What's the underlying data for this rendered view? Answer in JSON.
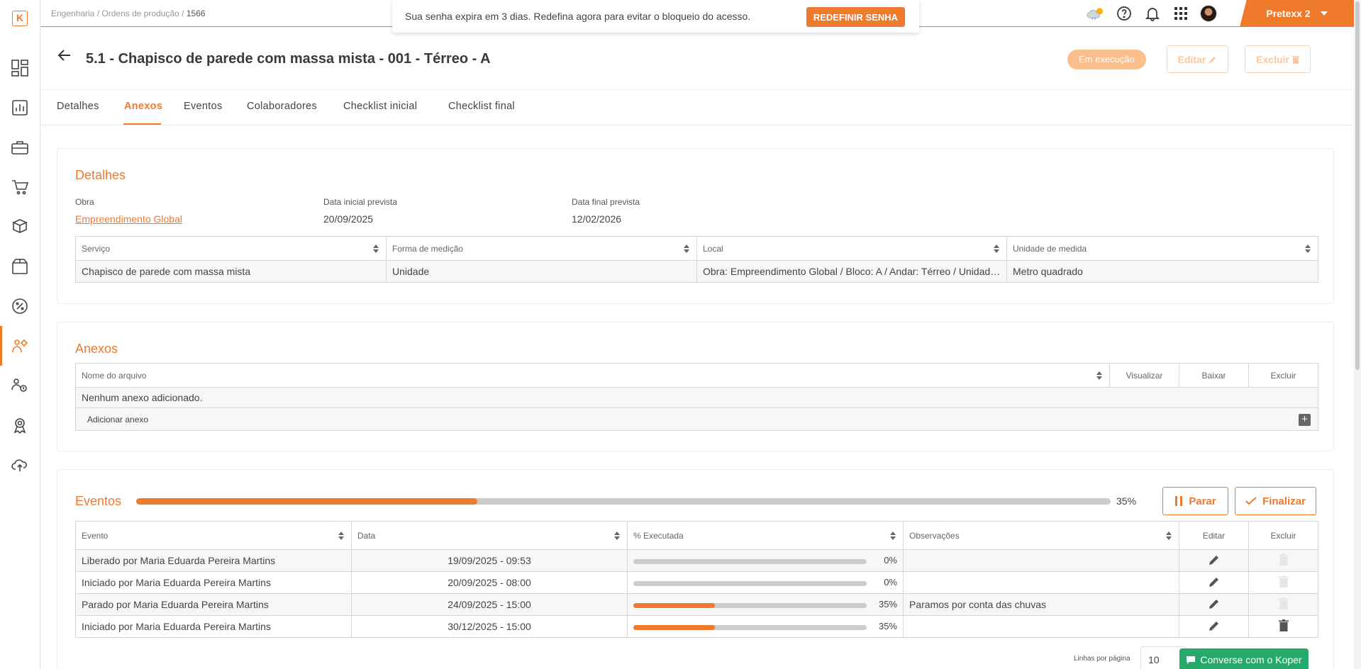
{
  "colors": {
    "accent": "#f07a2b",
    "chat": "#27a96b"
  },
  "logo": {
    "text": "K"
  },
  "sidebar": {
    "items": [
      {
        "icon": "dashboard-icon"
      },
      {
        "icon": "bar-chart-icon"
      },
      {
        "icon": "briefcase-icon"
      },
      {
        "icon": "cart-icon"
      },
      {
        "icon": "boxes-icon"
      },
      {
        "icon": "package-icon"
      },
      {
        "icon": "percent-icon"
      },
      {
        "icon": "engineering-icon",
        "active": true
      },
      {
        "icon": "team-settings-icon"
      },
      {
        "icon": "award-icon"
      },
      {
        "icon": "cloud-upload-icon"
      }
    ]
  },
  "breadcrumb": {
    "part1": "Engenharia",
    "sep": "/",
    "part2": "Ordens de produção",
    "current": "1566"
  },
  "alert": {
    "text": "Sua senha expira em 3 dias. Redefina agora para evitar o bloqueio do acesso.",
    "button": "REDEFINIR SENHA"
  },
  "topbar": {
    "user": "Pretexx 2"
  },
  "header": {
    "title": "5.1 - Chapisco de parede com massa mista - 001 - Térreo - A",
    "status": "Em execução",
    "edit": "Editar",
    "delete": "Excluir"
  },
  "tabs": [
    "Detalhes",
    "Anexos",
    "Eventos",
    "Colaboradores",
    "Checklist inicial",
    "Checklist final"
  ],
  "details": {
    "title": "Detalhes",
    "obra_label": "Obra",
    "obra_value": "Empreendimento Global",
    "start_label": "Data inicial prevista",
    "start_value": "20/09/2025",
    "end_label": "Data final prevista",
    "end_value": "12/02/2026",
    "table": {
      "headers": [
        "Serviço",
        "Forma de medição",
        "Local",
        "Unidade de medida"
      ],
      "row": [
        "Chapisco de parede com massa mista",
        "Unidade",
        "Obra: Empreendimento Global / Bloco: A / Andar: Térreo / Unidade...",
        "Metro quadrado"
      ]
    }
  },
  "attachments": {
    "title": "Anexos",
    "headers": [
      "Nome do arquivo",
      "Visualizar",
      "Baixar",
      "Excluir"
    ],
    "empty": "Nenhum anexo adicionado.",
    "add": "Adicionar anexo"
  },
  "events": {
    "title": "Eventos",
    "progress": 35,
    "progress_label": "35%",
    "stop": "Parar",
    "finish": "Finalizar",
    "headers": [
      "Evento",
      "Data",
      "% Executada",
      "Observações",
      "Editar",
      "Excluir"
    ],
    "rows": [
      {
        "event": "Liberado por Maria Eduarda Pereira Martins",
        "date": "19/09/2025 - 09:53",
        "pct": 0,
        "pct_label": "0%",
        "obs": "",
        "delete_enabled": false
      },
      {
        "event": "Iniciado por Maria Eduarda Pereira Martins",
        "date": "20/09/2025 - 08:00",
        "pct": 0,
        "pct_label": "0%",
        "obs": "",
        "delete_enabled": false
      },
      {
        "event": "Parado por Maria Eduarda Pereira Martins",
        "date": "24/09/2025 - 15:00",
        "pct": 35,
        "pct_label": "35%",
        "obs": "Paramos por conta das chuvas",
        "delete_enabled": false
      },
      {
        "event": "Iniciado por Maria Eduarda Pereira Martins",
        "date": "30/12/2025 - 15:00",
        "pct": 35,
        "pct_label": "35%",
        "obs": "",
        "delete_enabled": true
      }
    ],
    "rows_per_page_label": "Linhas por página",
    "rows_per_page": "10"
  },
  "chat": {
    "label": "Converse com o Koper"
  }
}
